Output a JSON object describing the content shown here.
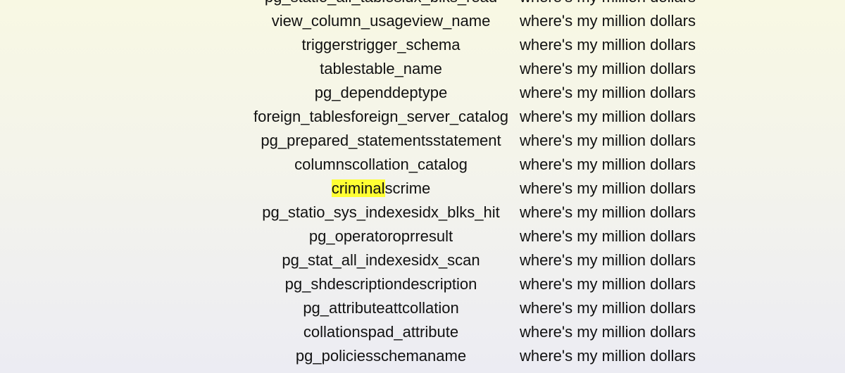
{
  "highlight_color": "#ffff33",
  "rows": [
    {
      "name": "pg_statio_all_tablesidx_blks_read",
      "value": "where's my million dollars"
    },
    {
      "name": "view_column_usageview_name",
      "value": "where's my million dollars"
    },
    {
      "name": "triggerstrigger_schema",
      "value": "where's my million dollars"
    },
    {
      "name": "tablestable_name",
      "value": "where's my million dollars"
    },
    {
      "name": "pg_dependdeptype",
      "value": "where's my million dollars"
    },
    {
      "name": "foreign_tablesforeign_server_catalog",
      "value": "where's my million dollars"
    },
    {
      "name": "pg_prepared_statementsstatement",
      "value": "where's my million dollars"
    },
    {
      "name": "columnscollation_catalog",
      "value": "where's my million dollars"
    },
    {
      "name": "criminalscrime",
      "highlight": "criminal",
      "rest": "scrime",
      "value": "where's my million dollars"
    },
    {
      "name": "pg_statio_sys_indexesidx_blks_hit",
      "value": "where's my million dollars"
    },
    {
      "name": "pg_operatoroprresult",
      "value": "where's my million dollars"
    },
    {
      "name": "pg_stat_all_indexesidx_scan",
      "value": "where's my million dollars"
    },
    {
      "name": "pg_shdescriptiondescription",
      "value": "where's my million dollars"
    },
    {
      "name": "pg_attributeattcollation",
      "value": "where's my million dollars"
    },
    {
      "name": "collationspad_attribute",
      "value": "where's my million dollars"
    },
    {
      "name": "pg_policiesschemaname",
      "value": "where's my million dollars"
    }
  ]
}
